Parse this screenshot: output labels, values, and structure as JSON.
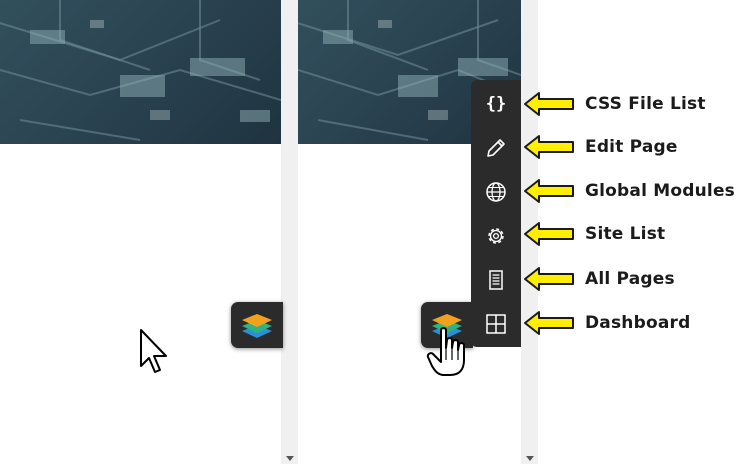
{
  "colors": {
    "toolbar_bg": "#2b2b2b",
    "arrow_fill": "#ffee00",
    "arrow_stroke": "#1b1b1b",
    "scrollbar": "#f0f0f0"
  },
  "left_panel": {
    "launcher_icon": "stacked-layers-icon",
    "cursor": "arrow-pointer-icon"
  },
  "right_panel": {
    "launcher_icon": "stacked-layers-icon",
    "cursor": "hand-pointer-icon",
    "toolbar": {
      "items": [
        {
          "icon": "curly-braces-icon",
          "glyph": "{}",
          "label": "CSS File List"
        },
        {
          "icon": "pencil-icon",
          "label": "Edit Page"
        },
        {
          "icon": "globe-icon",
          "label": "Global Modules"
        },
        {
          "icon": "gear-icon",
          "label": "Site List"
        },
        {
          "icon": "document-icon",
          "label": "All Pages"
        },
        {
          "icon": "dashboard-grid-icon",
          "label": "Dashboard"
        }
      ]
    }
  }
}
